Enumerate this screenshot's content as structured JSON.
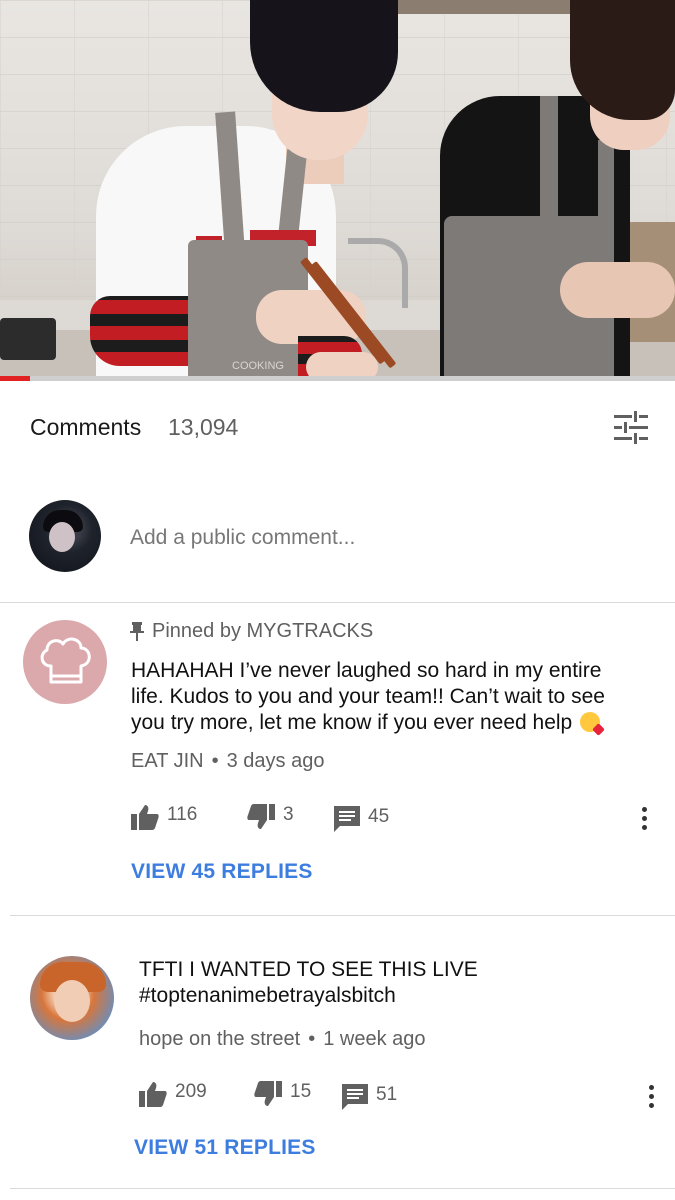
{
  "video": {
    "apron_print": "COOKING",
    "progress": 0.045
  },
  "comments_header": {
    "title": "Comments",
    "count": "13,094",
    "sort_icon": "tune-icon"
  },
  "add_comment": {
    "placeholder": "Add a public comment..."
  },
  "comments": [
    {
      "pinned_label": "Pinned by MYGTRACKS",
      "text": "HAHAHAH I’ve never laughed so hard in my entire life. Kudos to you and your team!! Can’t wait to see you try more, let me know if you ever need help",
      "emoji": "face-blowing-kiss",
      "author": "EAT JIN",
      "separator": "•",
      "time": "3 days ago",
      "likes": "116",
      "dislikes": "3",
      "replies": "45",
      "view_replies": "VIEW 45 REPLIES"
    },
    {
      "text_line1": "TFTI I WANTED TO SEE THIS LIVE",
      "text_line2": "#toptenanimebetrayalsbitch",
      "author": "hope on the street",
      "separator": "•",
      "time": "1 week ago",
      "likes": "209",
      "dislikes": "15",
      "replies": "51",
      "view_replies": "VIEW 51 REPLIES"
    }
  ]
}
